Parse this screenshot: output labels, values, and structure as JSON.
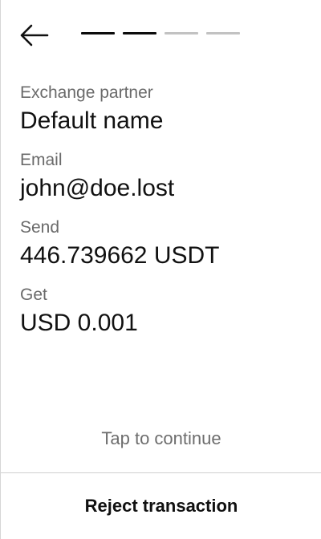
{
  "header": {
    "back_icon": "arrow-left-icon",
    "progress": {
      "total_steps": 4,
      "completed_steps": 2
    }
  },
  "details": {
    "partner_label": "Exchange partner",
    "partner_value": "Default name",
    "email_label": "Email",
    "email_value": "john@doe.lost",
    "send_label": "Send",
    "send_value": "446.739662 USDT",
    "get_label": "Get",
    "get_value": "USD 0.001"
  },
  "footer": {
    "tap_hint": "Tap to continue",
    "reject_label": "Reject transaction"
  },
  "colors": {
    "text_primary": "#111111",
    "text_secondary": "#6a6a6a",
    "progress_active": "#0b0b0b",
    "progress_inactive": "#c2c2c2",
    "divider": "#cfcfcf"
  }
}
